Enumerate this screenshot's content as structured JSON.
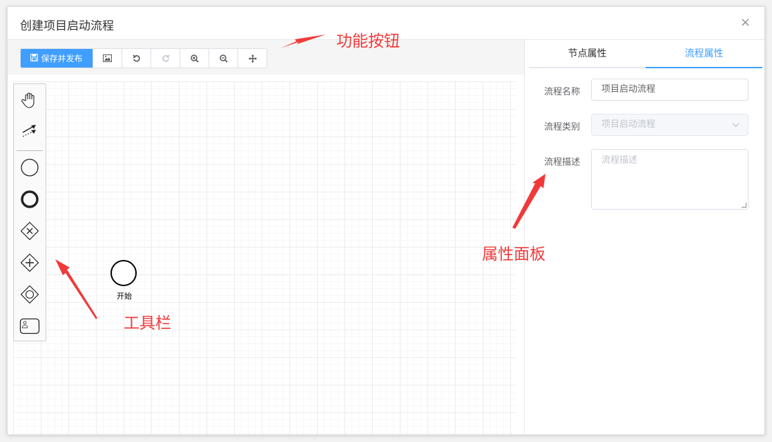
{
  "dialog": {
    "title": "创建项目启动流程",
    "close_glyph": "×"
  },
  "toolbar": {
    "save_label": "保存并发布",
    "buttons": [
      {
        "name": "export-image",
        "icon": "image-icon"
      },
      {
        "name": "undo",
        "icon": "undo-icon"
      },
      {
        "name": "redo",
        "icon": "redo-icon",
        "disabled": true
      },
      {
        "name": "zoom-in",
        "icon": "zoom-in-icon"
      },
      {
        "name": "zoom-out",
        "icon": "zoom-out-icon"
      },
      {
        "name": "fit",
        "icon": "move-icon"
      }
    ]
  },
  "palette": {
    "items": [
      "hand-tool-icon",
      "connect-tool-icon",
      "start-event-icon",
      "end-event-icon",
      "exclusive-gateway-icon",
      "parallel-gateway-icon",
      "inclusive-gateway-icon",
      "user-task-icon"
    ]
  },
  "diagram": {
    "start_label": "开始"
  },
  "panel": {
    "tabs": [
      {
        "label": "节点属性",
        "active": false
      },
      {
        "label": "流程属性",
        "active": true
      }
    ],
    "fields": {
      "name_label": "流程名称",
      "name_value": "项目启动流程",
      "type_label": "流程类别",
      "type_value": "项目启动流程",
      "desc_label": "流程描述",
      "desc_placeholder": "流程描述"
    }
  },
  "annotations": {
    "function_buttons": "功能按钮",
    "toolbar": "工具栏",
    "properties_panel": "属性面板"
  },
  "colors": {
    "accent": "#409eff",
    "annotation": "#f03a3a"
  }
}
